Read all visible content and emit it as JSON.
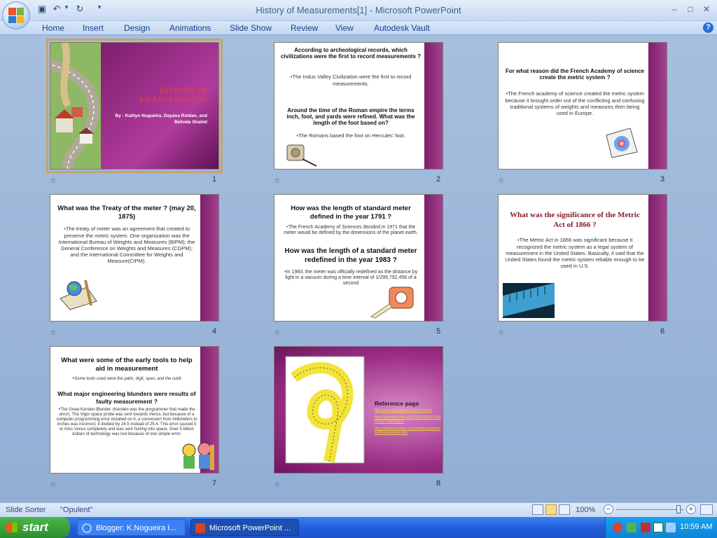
{
  "window": {
    "title": "History of Measurements[1] - Microsoft PowerPoint",
    "minimize": "–",
    "maximize": "□",
    "close": "✕"
  },
  "quick_access": {
    "save": "▣",
    "undo": "↶",
    "undo_menu": "▾",
    "redo": "↻",
    "customize": "▾"
  },
  "ribbon": {
    "tabs": [
      "Home",
      "Insert",
      "Design",
      "Animations",
      "Slide Show",
      "Review",
      "View",
      "Autodesk Vault"
    ],
    "help": "?"
  },
  "slides": [
    {
      "number": "1",
      "title": "HISTORY OF MEASUREMENTS",
      "subtitle": "By : Kaitlyn Nogueira, Dayana Roldan, and Belinda Shahid"
    },
    {
      "number": "2",
      "q1": "According to archeological records,  which civilizations were the first to record measurements ?",
      "a1": "The Indus Valley Civilization were the first to record measurements.",
      "q2": "Around the time of the Roman empire the terms inch, foot, and yards were refined. What was the length of the foot based on?",
      "a2": "The Romans based the foot on Hercules' foot."
    },
    {
      "number": "3",
      "q1": "For what reason did the French Academy of science create the metric system ?",
      "a1": "The French academy of science created the metric system because it brought order out of the conflicting and confusing traditional systems of weights and measures then being used in Europe."
    },
    {
      "number": "4",
      "q1": "What was the Treaty of the meter  ? (may 20,  1875)",
      "a1": "The treaty of meter was an agreement that created to preserve the metric system. One organization was the International Bureau of Weights and Measures (BIPM); the General Conference on Weights and Measures (CGPM); and the International Committee for Weights and Measure(CIPM)."
    },
    {
      "number": "5",
      "q1": "How was the length of standard meter defined in the year 1791 ?",
      "a1": "The French Academy of Sciences decided  in 1971 that the  meter would  be defined  by the dimensions of the planet earth.",
      "q2": "How was the length of a standard meter redefined in the year 1983  ?",
      "a2": "In 1983, the  meter was officially  redefined  as the distance  by light in a vacuum during  a time interval of 1/299,792,458  of a second"
    },
    {
      "number": "6",
      "q1": "What was the significance of the Metric Act of 1866 ?",
      "a1": "The Metric Act in 1866 was significant because it recognized the metric system as a legal system of measurement in the United States. Basically, it said that the United States found the metric system reliable enough to be used in U.S."
    },
    {
      "number": "7",
      "q1": "What were some of the early tools to help aid in measurement",
      "a1": "Some tools used were the palm, digit, span, and the cubit",
      "q2": "What major engineering blunders were results of faulty measurement ?",
      "a2": "The Great Kersten Blunder. (Kersten was the programmer that made the error). The Vigor space probe was sent towards Venus, but because of a computer programming error installed on it, a conversion from millimeters to inches was incorrect; it divided by 24.5 instead of 25.4. This error caused it to miss Venus completely and was sent hurling into space. Over 5 billion dollars of technology was lost because of one simple error."
    },
    {
      "number": "8",
      "title": "Reference page",
      "links": [
        "http://www.google.com/webhp?hl=en",
        "http://siterbook.rmu.edu/COSS/SCHISTANDARDTRANSHIST",
        "http://inventorsabout.com/od/measurementsofmeasuremen.htm"
      ]
    }
  ],
  "status": {
    "view": "Slide Sorter",
    "theme": "\"Opulent\"",
    "zoom": "100%",
    "zoom_out": "−",
    "zoom_in": "+"
  },
  "taskbar": {
    "start": "start",
    "items": [
      "Blogger: K.Nogueira I...",
      "Microsoft PowerPoint ..."
    ],
    "clock": "10:59 AM"
  },
  "colors": {
    "band": "#7d1e6c",
    "accent": "#a3428e",
    "ribbon_text": "#15428b"
  }
}
